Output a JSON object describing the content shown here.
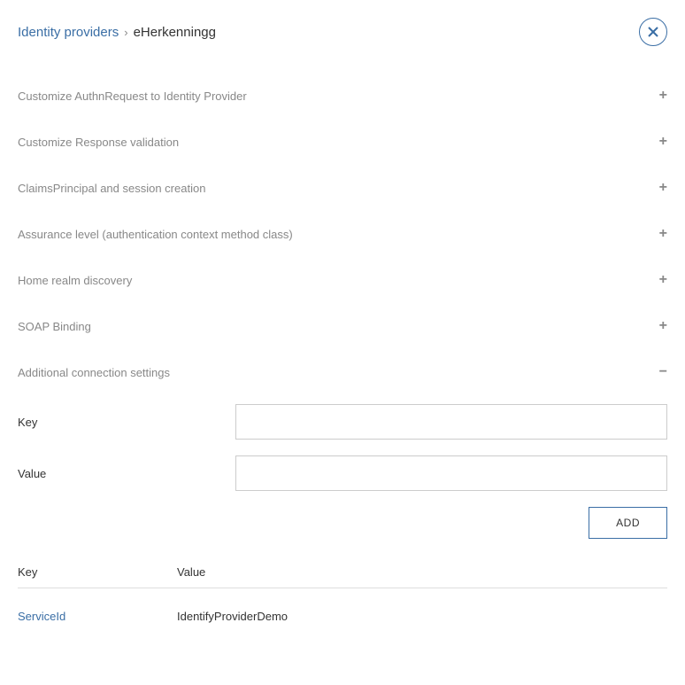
{
  "breadcrumb": {
    "parent": "Identity providers",
    "separator": "›",
    "current": "eHerkenningg"
  },
  "accordion": [
    {
      "title": "Customize AuthnRequest to Identity Provider",
      "expanded": false
    },
    {
      "title": "Customize Response validation",
      "expanded": false
    },
    {
      "title": "ClaimsPrincipal and session creation",
      "expanded": false
    },
    {
      "title": "Assurance level (authentication context method class)",
      "expanded": false
    },
    {
      "title": "Home realm discovery",
      "expanded": false
    },
    {
      "title": "SOAP Binding",
      "expanded": false
    },
    {
      "title": "Additional connection settings",
      "expanded": true
    }
  ],
  "form": {
    "key_label": "Key",
    "value_label": "Value",
    "key_value": "",
    "value_value": "",
    "add_button": "ADD"
  },
  "table": {
    "headers": {
      "key": "Key",
      "value": "Value"
    },
    "rows": [
      {
        "key": "ServiceId",
        "value": "IdentifyProviderDemo"
      }
    ]
  }
}
